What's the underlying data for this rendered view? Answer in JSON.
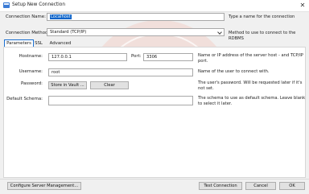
{
  "window": {
    "title": "Setup New Connection",
    "close_glyph": "✕"
  },
  "connection_name": {
    "label": "Connection Name:",
    "value": "Localhost",
    "hint": "Type a name for the connection"
  },
  "connection_method": {
    "label": "Connection Method:",
    "value": "Standard (TCP/IP)",
    "hint": "Method to use to connect to the RDBMS"
  },
  "tabs": [
    {
      "label": "Parameters",
      "active": true
    },
    {
      "label": "SSL",
      "active": false
    },
    {
      "label": "Advanced",
      "active": false
    }
  ],
  "hostname": {
    "label": "Hostname:",
    "value": "127.0.0.1"
  },
  "port": {
    "label": "Port:",
    "value": "3306"
  },
  "hostname_hint": "Name or IP address of the server host - and TCP/IP port.",
  "username": {
    "label": "Username:",
    "value": "root",
    "hint": "Name of the user to connect with."
  },
  "password": {
    "label": "Password:",
    "store_button": "Store in Vault ...",
    "clear_button": "Clear",
    "hint": "The user's password. Will be requested later if it's not set."
  },
  "default_schema": {
    "label": "Default Schema:",
    "value": "",
    "hint": "The schema to use as default schema. Leave blank to select it later."
  },
  "footer": {
    "configure_button": "Configure Server Management...",
    "test_button": "Test Connection",
    "cancel_button": "Cancel",
    "ok_button": "OK"
  },
  "colors": {
    "accent": "#1a6fd1",
    "selection": "#0a63c9",
    "watermark": "#e9b7ad"
  },
  "icons": [
    "app-window-icon",
    "close-icon",
    "chevron-down-icon",
    "logo-watermark"
  ]
}
